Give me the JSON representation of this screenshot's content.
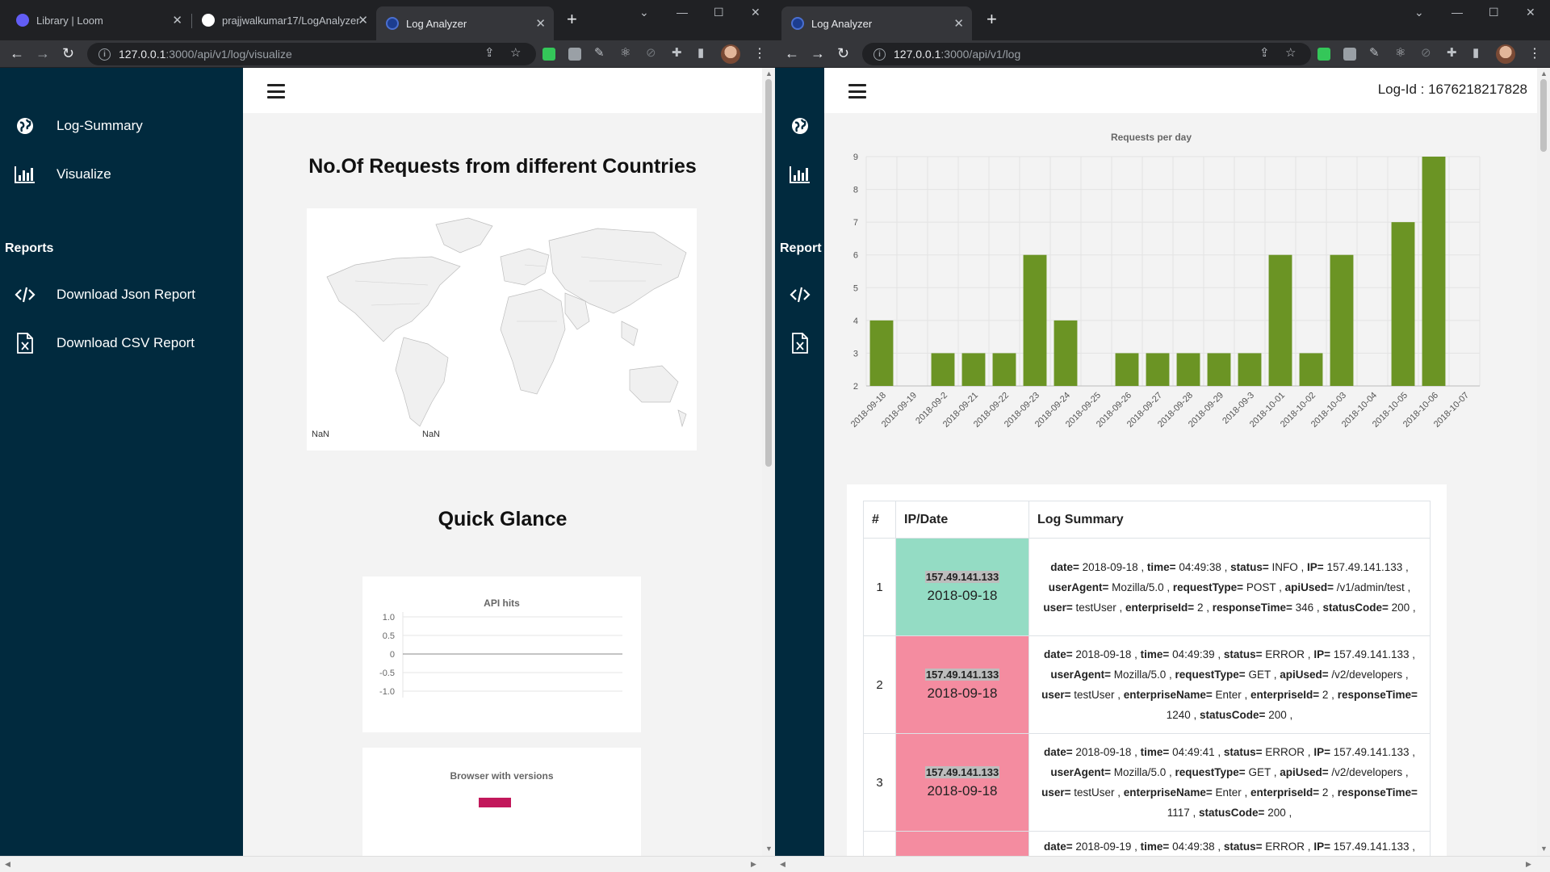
{
  "left": {
    "tabs": [
      {
        "label": "Library | Loom",
        "favicon_color": "#625df5"
      },
      {
        "label": "prajjwalkumar17/LogAnalyzer",
        "favicon_color": "#ffffff"
      },
      {
        "label": "Log Analyzer",
        "favicon_color": "#1c3d8f"
      }
    ],
    "url_host": "127.0.0.1",
    "url_rest": ":3000/api/v1/log/visualize",
    "sidebar": {
      "items": [
        {
          "label": "Log-Summary",
          "icon": "globe-icon"
        },
        {
          "label": "Visualize",
          "icon": "bar-chart-icon"
        }
      ],
      "reports_heading": "Reports",
      "report_items": [
        {
          "label": "Download Json Report",
          "icon": "code-icon"
        },
        {
          "label": "Download CSV Report",
          "icon": "excel-file-icon"
        }
      ]
    },
    "map_title": "No.Of Requests from different Countries",
    "map_labels": [
      "NaN",
      "NaN"
    ],
    "quick_glance": "Quick Glance",
    "api_hits": {
      "title": "API hits",
      "yticks": [
        "1.0",
        "0.5",
        "0",
        "-0.5",
        "-1.0"
      ]
    },
    "browser": {
      "title": "Browser with versions",
      "legend_color": "#c2185b"
    }
  },
  "right": {
    "tab_label": "Log Analyzer",
    "url_host": "127.0.0.1",
    "url_rest": ":3000/api/v1/log",
    "log_id_label": "Log-Id : 1676218217828",
    "sidebar_partial_heading": "Report",
    "chart_data": {
      "type": "bar",
      "title": "Requests per day",
      "categories": [
        "2018-09-18",
        "2018-09-19",
        "2018-09-2",
        "2018-09-21",
        "2018-09-22",
        "2018-09-23",
        "2018-09-24",
        "2018-09-25",
        "2018-09-26",
        "2018-09-27",
        "2018-09-28",
        "2018-09-29",
        "2018-09-3",
        "2018-10-01",
        "2018-10-02",
        "2018-10-03",
        "2018-10-04",
        "2018-10-05",
        "2018-10-06",
        "2018-10-07"
      ],
      "values": [
        4,
        2,
        3,
        3,
        3,
        6,
        4,
        2,
        3,
        3,
        3,
        3,
        3,
        6,
        3,
        6,
        2,
        7,
        9,
        2
      ],
      "ylim": [
        2,
        9
      ],
      "yticks": [
        2,
        3,
        4,
        5,
        6,
        7,
        8,
        9
      ],
      "bar_color": "#6b9424",
      "grid": true
    },
    "table": {
      "headers": [
        "#",
        "IP/Date",
        "Log Summary"
      ],
      "rows": [
        {
          "num": "1",
          "ip": "157.49.141.133",
          "date": "2018-09-18",
          "status_color": "#94dcc4",
          "fields": [
            {
              "k": "date=",
              "v": "2018-09-18"
            },
            {
              "k": "time=",
              "v": "04:49:38"
            },
            {
              "k": "status=",
              "v": "INFO"
            },
            {
              "k": "IP=",
              "v": "157.49.141.133"
            },
            {
              "k": "userAgent=",
              "v": "Mozilla/5.0"
            },
            {
              "k": "requestType=",
              "v": "POST"
            },
            {
              "k": "apiUsed=",
              "v": "/v1/admin/test"
            },
            {
              "k": "user=",
              "v": "testUser"
            },
            {
              "k": "enterpriseId=",
              "v": "2"
            },
            {
              "k": "responseTime=",
              "v": "346"
            },
            {
              "k": "statusCode=",
              "v": "200"
            }
          ]
        },
        {
          "num": "2",
          "ip": "157.49.141.133",
          "date": "2018-09-18",
          "status_color": "#f48ca0",
          "fields": [
            {
              "k": "date=",
              "v": "2018-09-18"
            },
            {
              "k": "time=",
              "v": "04:49:39"
            },
            {
              "k": "status=",
              "v": "ERROR"
            },
            {
              "k": "IP=",
              "v": "157.49.141.133"
            },
            {
              "k": "userAgent=",
              "v": "Mozilla/5.0"
            },
            {
              "k": "requestType=",
              "v": "GET"
            },
            {
              "k": "apiUsed=",
              "v": "/v2/developers"
            },
            {
              "k": "user=",
              "v": "testUser"
            },
            {
              "k": "enterpriseName=",
              "v": "Enter"
            },
            {
              "k": "enterpriseId=",
              "v": "2"
            },
            {
              "k": "responseTime=",
              "v": "1240"
            },
            {
              "k": "statusCode=",
              "v": "200"
            }
          ]
        },
        {
          "num": "3",
          "ip": "157.49.141.133",
          "date": "2018-09-18",
          "status_color": "#f48ca0",
          "fields": [
            {
              "k": "date=",
              "v": "2018-09-18"
            },
            {
              "k": "time=",
              "v": "04:49:41"
            },
            {
              "k": "status=",
              "v": "ERROR"
            },
            {
              "k": "IP=",
              "v": "157.49.141.133"
            },
            {
              "k": "userAgent=",
              "v": "Mozilla/5.0"
            },
            {
              "k": "requestType=",
              "v": "GET"
            },
            {
              "k": "apiUsed=",
              "v": "/v2/developers"
            },
            {
              "k": "user=",
              "v": "testUser"
            },
            {
              "k": "enterpriseName=",
              "v": "Enter"
            },
            {
              "k": "enterpriseId=",
              "v": "2"
            },
            {
              "k": "responseTime=",
              "v": "1117"
            },
            {
              "k": "statusCode=",
              "v": "200"
            }
          ]
        },
        {
          "num": "",
          "ip": "",
          "date": "",
          "status_color": "#f48ca0",
          "fields": [
            {
              "k": "date=",
              "v": "2018-09-19"
            },
            {
              "k": "time=",
              "v": "04:49:38"
            },
            {
              "k": "status=",
              "v": "ERROR"
            },
            {
              "k": "IP=",
              "v": "157.49.141.133"
            }
          ]
        }
      ]
    }
  }
}
